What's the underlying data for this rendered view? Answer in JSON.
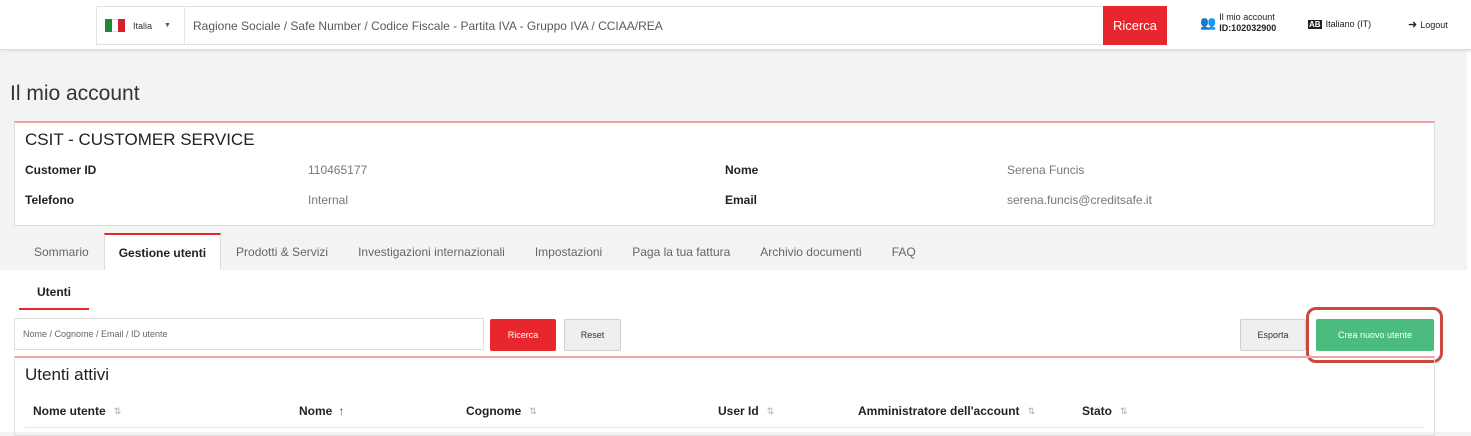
{
  "header": {
    "country": {
      "name": "Italia",
      "flag_colors": [
        "#1a8a3a",
        "#ffffff",
        "#d8202b"
      ]
    },
    "search_placeholder": "Ragione Sociale / Safe Number / Codice Fiscale - Partita IVA - Gruppo IVA / CCIAA/REA",
    "search_button": "Ricerca",
    "account_line1": "Il mio account",
    "account_line2": "ID:102032900",
    "language": "Italiano (IT)",
    "logout": "Logout"
  },
  "page_title": "Il mio account",
  "customer": {
    "name": "CSIT - CUSTOMER SERVICE",
    "fields": {
      "customer_id_label": "Customer ID",
      "customer_id": "110465177",
      "telefono_label": "Telefono",
      "telefono": "Internal",
      "nome_label": "Nome",
      "nome": "Serena Funcis",
      "email_label": "Email",
      "email": "serena.funcis@creditsafe.it"
    }
  },
  "tabs": [
    {
      "label": "Sommario",
      "active": false
    },
    {
      "label": "Gestione utenti",
      "active": true
    },
    {
      "label": "Prodotti & Servizi",
      "active": false
    },
    {
      "label": "Investigazioni internazionali",
      "active": false
    },
    {
      "label": "Impostazioni",
      "active": false
    },
    {
      "label": "Paga la tua fattura",
      "active": false
    },
    {
      "label": "Archivio documenti",
      "active": false
    },
    {
      "label": "FAQ",
      "active": false
    }
  ],
  "users": {
    "subtab": "Utenti",
    "filter_placeholder": "Nome / Cognome / Email / ID utente",
    "search_button": "Ricerca",
    "reset_button": "Reset",
    "export_button": "Esporta",
    "create_button": "Crea nuovo utente",
    "section_title": "Utenti attivi",
    "columns": [
      "Nome utente",
      "Nome",
      "Cognome",
      "User Id",
      "Amministratore dell'account",
      "Stato"
    ]
  },
  "colors": {
    "accent_red": "#e8262e",
    "create_green": "#4cbc7e",
    "highlight": "#c84a3e"
  }
}
